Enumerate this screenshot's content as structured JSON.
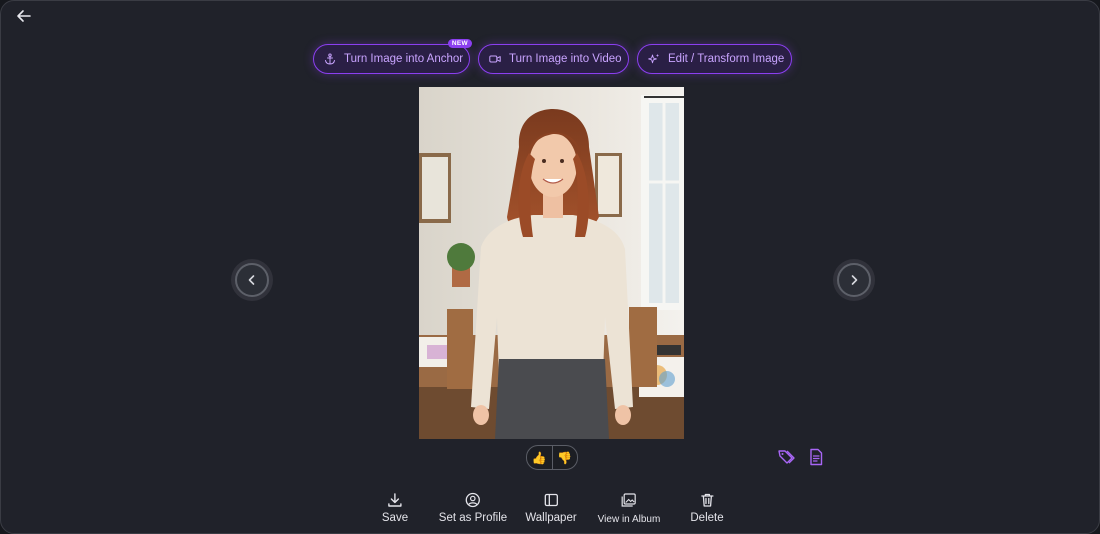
{
  "header": {
    "back_icon": "arrow-left-icon"
  },
  "actions": [
    {
      "label": "Turn Image into Anchor",
      "icon": "anchor-icon",
      "badge": "NEW"
    },
    {
      "label": "Turn Image into Video",
      "icon": "video-camera-icon"
    },
    {
      "label": "Edit / Transform Image",
      "icon": "sparkles-icon"
    }
  ],
  "viewer": {
    "image_description": "Woman with long auburn hair in a cream sweater standing in a bright art room",
    "prev_icon": "chevron-left-icon",
    "next_icon": "chevron-right-icon"
  },
  "feedback": {
    "like": "👍",
    "dislike": "👎"
  },
  "side_tools": [
    {
      "icon": "tags-icon"
    },
    {
      "icon": "document-icon"
    }
  ],
  "bottom_bar": [
    {
      "label": "Save",
      "icon": "download-icon"
    },
    {
      "label": "Set as Profile",
      "icon": "user-circle-icon"
    },
    {
      "label": "Wallpaper",
      "icon": "wallpaper-icon"
    },
    {
      "label": "View in Album",
      "icon": "album-icon"
    },
    {
      "label": "Delete",
      "icon": "trash-icon"
    }
  ],
  "colors": {
    "accent": "#8b3ff0",
    "accent_text": "#c9a4ff",
    "background": "#20222a"
  }
}
